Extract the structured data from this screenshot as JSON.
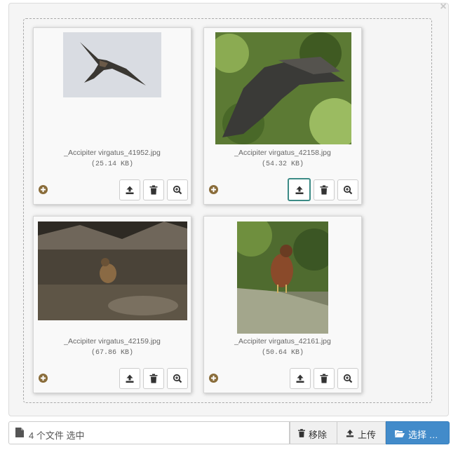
{
  "files": [
    {
      "name": "_Accipiter virgatus_41952.jpg",
      "size": "(25.14 KB)"
    },
    {
      "name": "_Accipiter virgatus_42158.jpg",
      "size": "(54.32 KB)"
    },
    {
      "name": "_Accipiter virgatus_42159.jpg",
      "size": "(67.86 KB)"
    },
    {
      "name": "_Accipiter virgatus_42161.jpg",
      "size": "(50.64 KB)"
    }
  ],
  "footer": {
    "caption": "4 个文件 选中",
    "remove_label": "移除",
    "upload_label": "上传",
    "browse_label": "选择 …"
  },
  "close_glyph": "×",
  "colors": {
    "accent": "#428bca",
    "plus_icon": "#8a6d3b",
    "focus_border": "#3c8b86"
  }
}
